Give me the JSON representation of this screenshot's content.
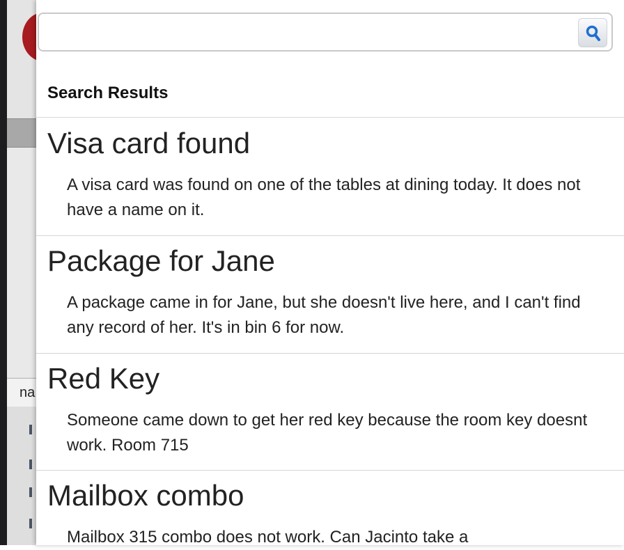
{
  "background": {
    "row_label": "na"
  },
  "search": {
    "value": "",
    "placeholder": ""
  },
  "results": {
    "heading": "Search Results",
    "items": [
      {
        "title": "Visa card found",
        "body": "A visa card was found on one of the tables at dining today. It does not have a name on it."
      },
      {
        "title": "Package for Jane",
        "body": "A package came in for Jane, but she doesn't live here, and I can't find any record of her. It's in bin 6 for now."
      },
      {
        "title": "Red Key",
        "body": "Someone came down to get her red key because the room key doesnt work. Room 715"
      },
      {
        "title": "Mailbox combo",
        "body": "Mailbox 315 combo does not work. Can Jacinto take a"
      }
    ]
  },
  "icons": {
    "search": "magnifier-icon"
  },
  "colors": {
    "accent": "#1e6fd0",
    "divider": "#d6d6d6"
  }
}
